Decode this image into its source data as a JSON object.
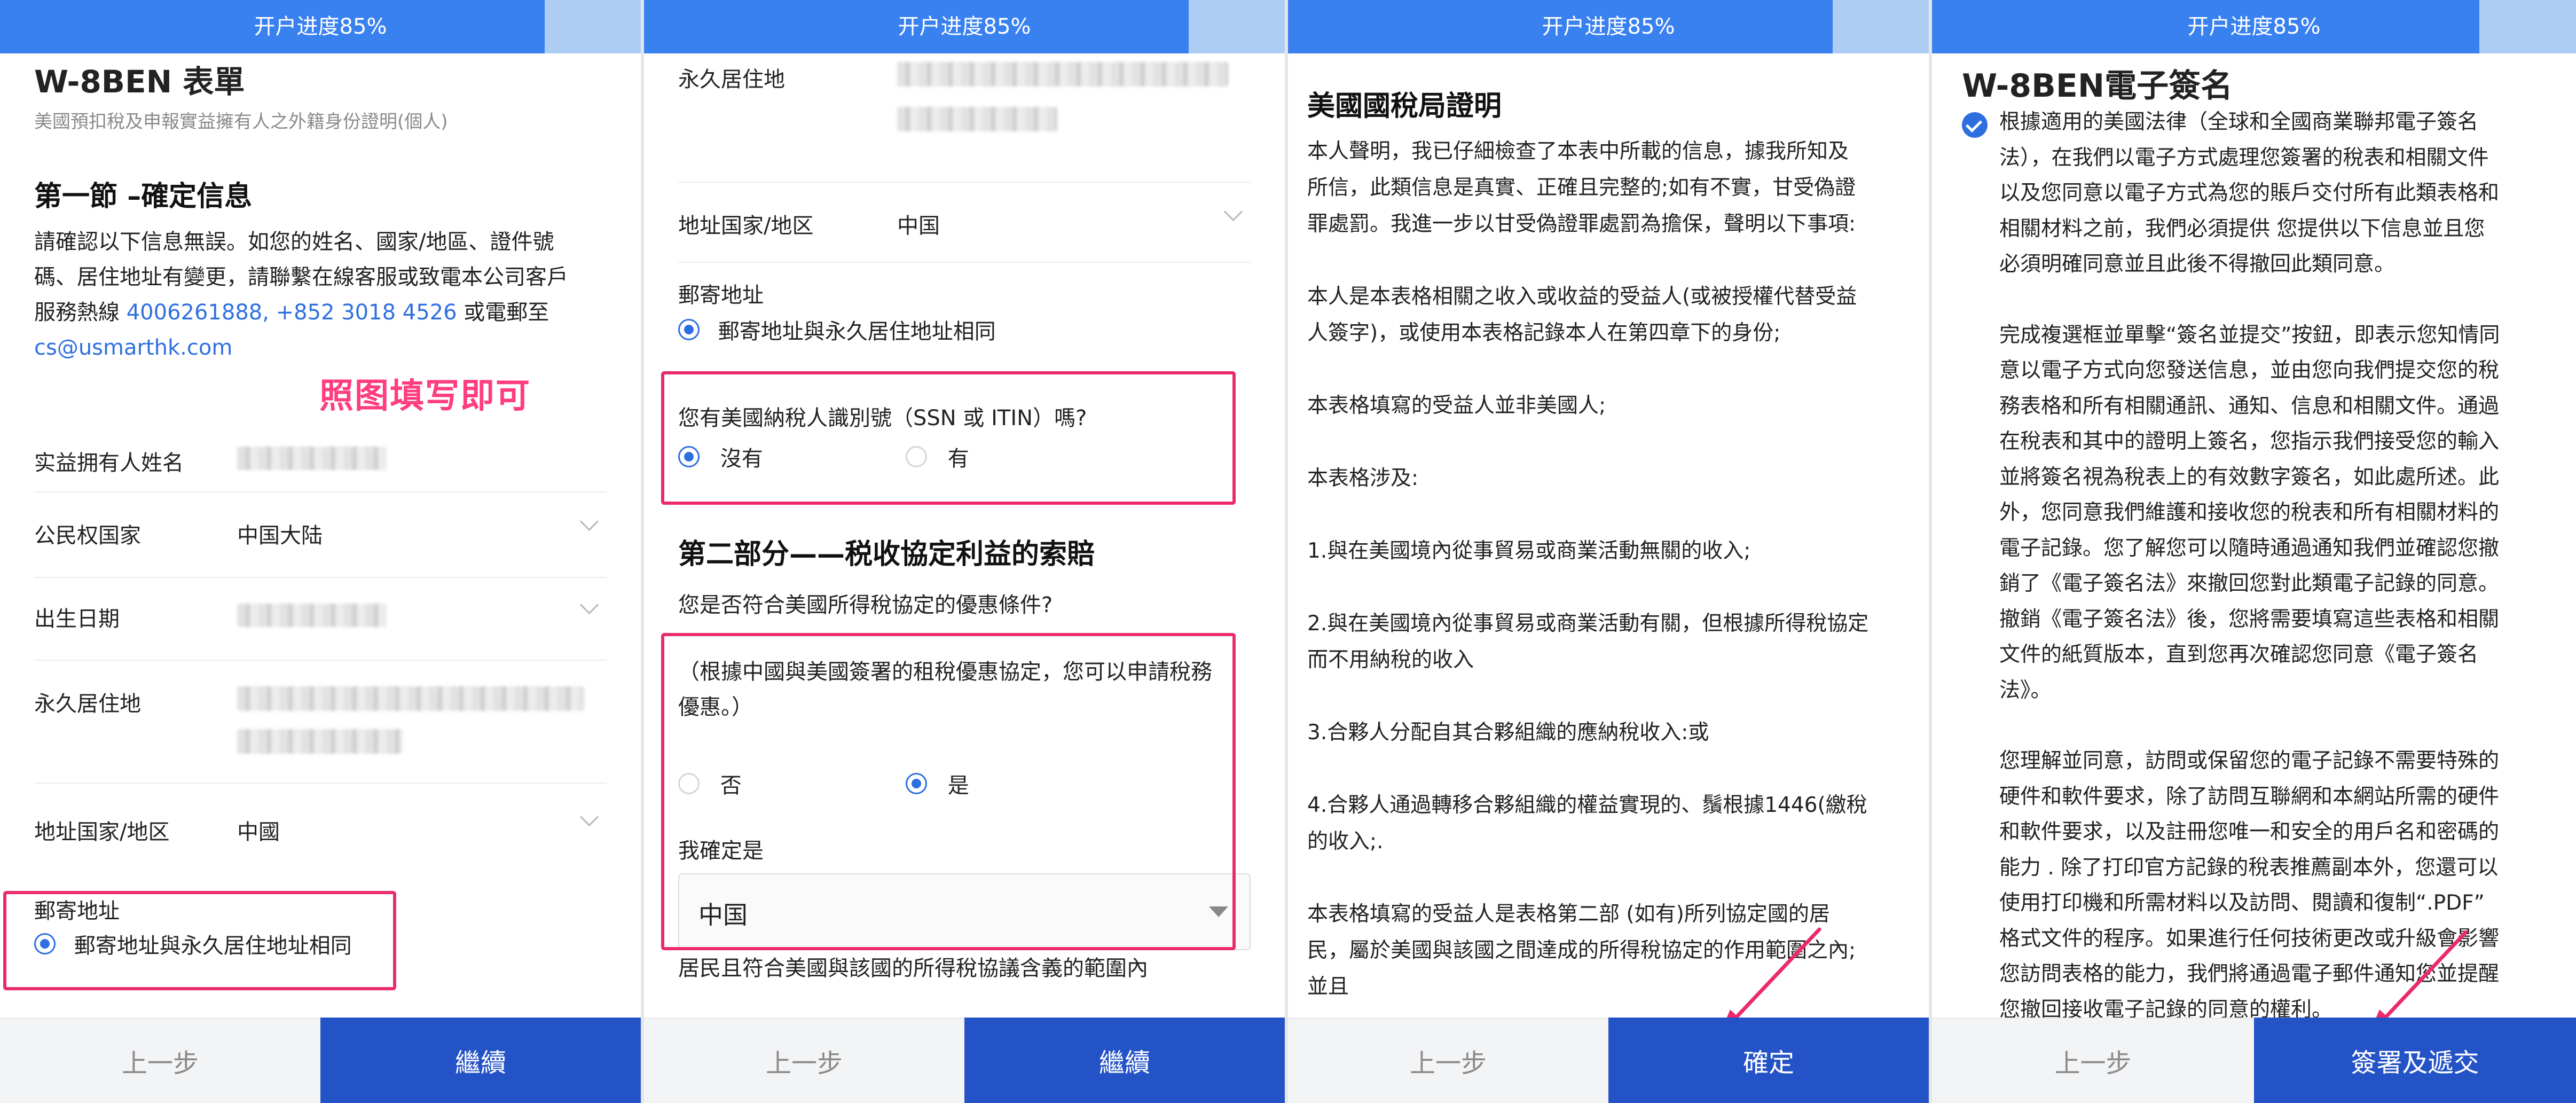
{
  "progress": {
    "label": "开户进度85%",
    "percent": 85
  },
  "colors": {
    "accent": "#3a81f0",
    "primary_button": "#2453c7",
    "annotation": "#ea2a6d"
  },
  "footer": {
    "prev": "上一步",
    "next": "繼續",
    "confirm": "確定",
    "sign": "簽署及遞交"
  },
  "panel1": {
    "title": "W-8BEN 表單",
    "subtitle": "美國預扣稅及申報實益擁有人之外籍身份證明(個人)",
    "section_title": "第一節 –確定信息",
    "intro_1": "請確認以下信息無誤。如您的姓名、國家/地區、證件號",
    "intro_2": "碼、居住地址有變更，請聯繫在線客服或致電本公司客戶",
    "intro_3": "服務熱線 ",
    "phone_1": "4006261888",
    "sep": ", ",
    "phone_2": "+852 3018 4526",
    "intro_4": " 或電郵至",
    "email": "cs@usmarthk.com",
    "annotation": "照图填写即可",
    "fields": {
      "owner_name": "实益拥有人姓名",
      "citizenship": "公民权国家",
      "citizenship_value": "中国大陆",
      "birth_date": "出生日期",
      "residence": "永久居住地",
      "address_country": "地址国家/地区",
      "address_country_value": "中國"
    },
    "mailing": {
      "label": "郵寄地址",
      "option": "郵寄地址與永久居住地址相同"
    }
  },
  "panel2": {
    "residence": "永久居住地",
    "address_country": "地址国家/地区",
    "address_country_value": "中国",
    "mailing_label": "郵寄地址",
    "mailing_option": "郵寄地址與永久居住地址相同",
    "tin_question": "您有美國納稅人識別號（SSN 或 ITIN）嗎?",
    "tin_no": "沒有",
    "tin_yes": "有",
    "part2_title": "第二部分——税收協定利益的索賠",
    "treaty_question": "您是否符合美國所得稅協定的優惠條件?",
    "treaty_note_1": "（根據中國與美國簽署的租稅優惠協定，您可以申請稅務",
    "treaty_note_2": "優惠。）",
    "treaty_no": "否",
    "treaty_yes": "是",
    "confirm_label": "我確定是",
    "country_select": "中国",
    "resident_text": "居民且符合美國與該國的所得稅協議含義的範圍內"
  },
  "panel3": {
    "title": "美國國稅局證明",
    "paragraphs": [
      [
        "本人聲明，我已仔細檢查了本表中所載的信息，據我所知及",
        "所信，此類信息是真實、正確且完整的;如有不實，甘受偽證",
        "罪處罰。我進一步以甘受偽證罪處罰為擔保，聲明以下事項:"
      ],
      [
        "本人是本表格相關之收入或收益的受益人(或被授權代替受益",
        "人簽字)，或使用本表格記錄本人在第四章下的身份;"
      ],
      [
        "本表格填寫的受益人並非美國人;"
      ],
      [
        "本表格涉及:"
      ],
      [
        "1.與在美國境內從事貿易或商業活動無關的收入;"
      ],
      [
        "2.與在美國境內從事貿易或商業活動有關，但根據所得稅協定",
        "而不用納稅的收入"
      ],
      [
        "3.合夥人分配自其合夥組織的應納稅收入:或"
      ],
      [
        "4.合夥人通過轉移合夥組織的權益實現的、鬚根據1446(繳稅",
        "的收入;."
      ],
      [
        "本表格填寫的受益人是表格第二部 (如有)所列協定國的居",
        "民，屬於美國與該國之間達成的所得稅協定的作用範圍之內;",
        "並且"
      ]
    ]
  },
  "panel4": {
    "title": "W-8BEN電子簽名",
    "paragraphs": [
      [
        "根據適用的美國法律（全球和全國商業聯邦電子簽名",
        "法），在我們以電子方式處理您簽署的稅表和相關文件",
        "以及您同意以電子方式為您的賬戶交付所有此類表格和",
        "相關材料之前，我們必須提供 您提供以下信息並且您",
        "必須明確同意並且此後不得撤回此類同意。"
      ],
      [
        "完成複選框並單擊“簽名並提交”按鈕，即表示您知情同",
        "意以電子方式向您發送信息，並由您向我們提交您的稅",
        "務表格和所有相關通訊、通知、信息和相關文件。通過",
        "在稅表和其中的證明上簽名，您指示我們接受您的輸入",
        "並將簽名視為稅表上的有效數字簽名，如此處所述。此",
        "外，您同意我們維護和接收您的稅表和所有相關材料的",
        "電子記錄。您了解您可以隨時通過通知我們並確認您撤",
        "銷了《電子簽名法》來撤回您對此類電子記錄的同意。",
        "撤銷《電子簽名法》後，您將需要填寫這些表格和相關",
        "文件的紙質版本，直到您再次確認您同意《電子簽名",
        "法》。"
      ],
      [
        "您理解並同意，訪問或保留您的電子記錄不需要特殊的",
        "硬件和軟件要求，除了訪問互聯網和本網站所需的硬件",
        "和軟件要求，以及註冊您唯一和安全的用戶名和密碼的",
        "能力 . 除了打印官方記錄的稅表推薦副本外，您還可以",
        "使用打印機和所需材料以及訪問、閱讀和復制“.PDF”",
        "格式文件的程序。如果進行任何技術更改或升級會影響",
        "您訪問表格的能力，我們將通過電子郵件通知您並提醒",
        "您撤回接收電子記錄的同意的權利。"
      ]
    ]
  }
}
